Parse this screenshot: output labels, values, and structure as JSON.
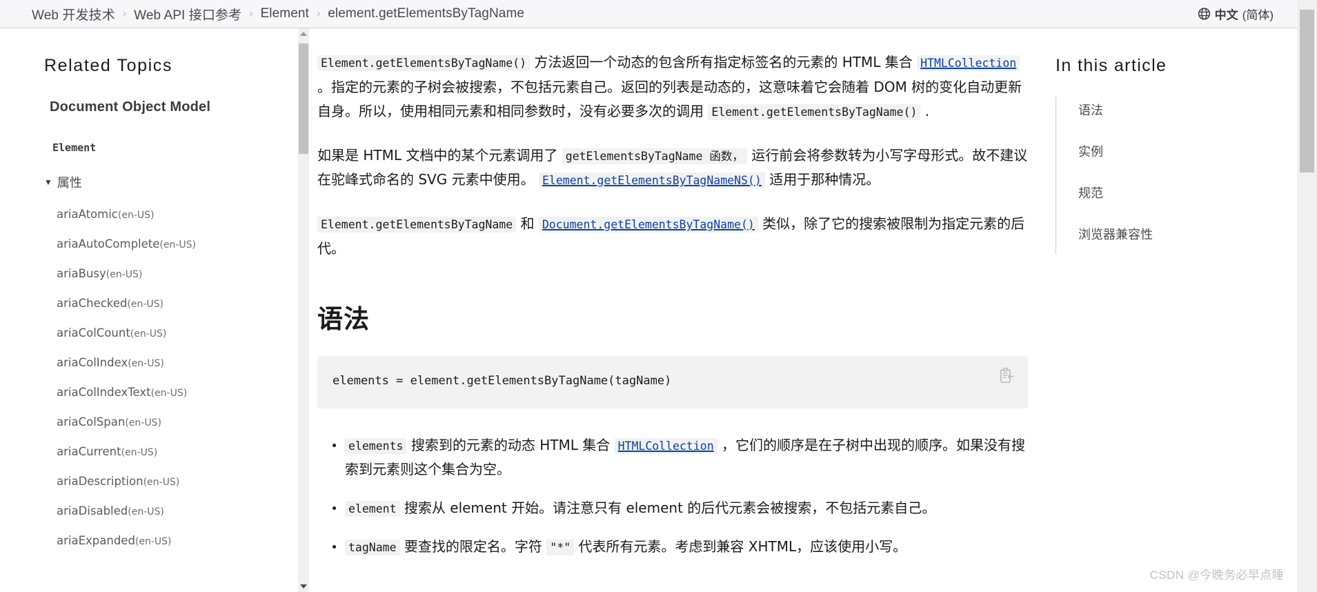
{
  "header": {
    "breadcrumb": [
      {
        "label": "Web 开发技术"
      },
      {
        "label": "Web API 接口参考"
      },
      {
        "label": "Element"
      },
      {
        "label": "element.getElementsByTagName"
      }
    ],
    "separator": "›",
    "language": {
      "icon": "globe-icon",
      "label": "中文",
      "variant": "(简体)"
    }
  },
  "sidebar": {
    "related_topics_title": "Related Topics",
    "dom_title": "Document Object Model",
    "element_label": "Element",
    "group": {
      "caret": "▼",
      "label": "属性"
    },
    "items": [
      {
        "name": "ariaAtomic",
        "lang": "(en-US)"
      },
      {
        "name": "ariaAutoComplete",
        "lang": "(en-US)"
      },
      {
        "name": "ariaBusy",
        "lang": "(en-US)"
      },
      {
        "name": "ariaChecked",
        "lang": "(en-US)"
      },
      {
        "name": "ariaColCount",
        "lang": "(en-US)"
      },
      {
        "name": "ariaColIndex",
        "lang": "(en-US)"
      },
      {
        "name": "ariaColIndexText",
        "lang": "(en-US)"
      },
      {
        "name": "ariaColSpan",
        "lang": "(en-US)"
      },
      {
        "name": "ariaCurrent",
        "lang": "(en-US)"
      },
      {
        "name": "ariaDescription",
        "lang": "(en-US)"
      },
      {
        "name": "ariaDisabled",
        "lang": "(en-US)"
      },
      {
        "name": "ariaExpanded",
        "lang": "(en-US)"
      }
    ]
  },
  "article": {
    "intro": {
      "code1": "Element.getElementsByTagName()",
      "text1": " 方法返回一个动态的包含所有指定标签名的元素的 HTML 集合 ",
      "link1": "HTMLCollection",
      "text2": " 。指定的元素的子树会被搜索，不包括元素自己。返回的列表是动态的，这意味着它会随着 DOM 树的变化自动更新自身。所以，使用相同元素和相同参数时，没有必要多次的调用 ",
      "code2": "Element.getElementsByTagName()",
      "text3": " ."
    },
    "para2": {
      "text1": "如果是 HTML 文档中的某个元素调用了 ",
      "code1": "getElementsByTagName 函数，",
      "text2": " 运行前会将参数转为小写字母形式。故不建议在驼峰式命名的 SVG 元素中使用。 ",
      "link1": "Element.getElementsByTagNameNS()",
      "text3": " 适用于那种情况。"
    },
    "para3": {
      "code1": "Element.getElementsByTagName",
      "text1": " 和 ",
      "link1": "Document.getElementsByTagName()",
      "text2": " 类似，除了它的搜索被限制为指定元素的后代。"
    },
    "syntax_heading": "语法",
    "code_block": "elements = element.getElementsByTagName(tagName)",
    "copy_icon": "copy-clipboard-icon",
    "bullets": [
      {
        "code": "elements",
        "text1": " 搜索到的元素的动态 HTML 集合 ",
        "link": "HTMLCollection",
        "text2": " ，它们的顺序是在子树中出现的顺序。如果没有搜索到元素则这个集合为空。"
      },
      {
        "code": "element",
        "text1": " 搜索从 element 开始。请注意只有 element 的后代元素会被搜索，不包括元素自己。",
        "link": "",
        "text2": ""
      },
      {
        "code": "tagName",
        "text1": " 要查找的限定名。字符 ",
        "code2": "\"*\"",
        "text2": " 代表所有元素。考虑到兼容 XHTML，应该使用小写。"
      }
    ]
  },
  "toc": {
    "title": "In this article",
    "items": [
      {
        "label": "语法"
      },
      {
        "label": "实例"
      },
      {
        "label": "规范"
      },
      {
        "label": "浏览器兼容性"
      }
    ]
  },
  "watermark": "CSDN @今晚务必早点睡"
}
